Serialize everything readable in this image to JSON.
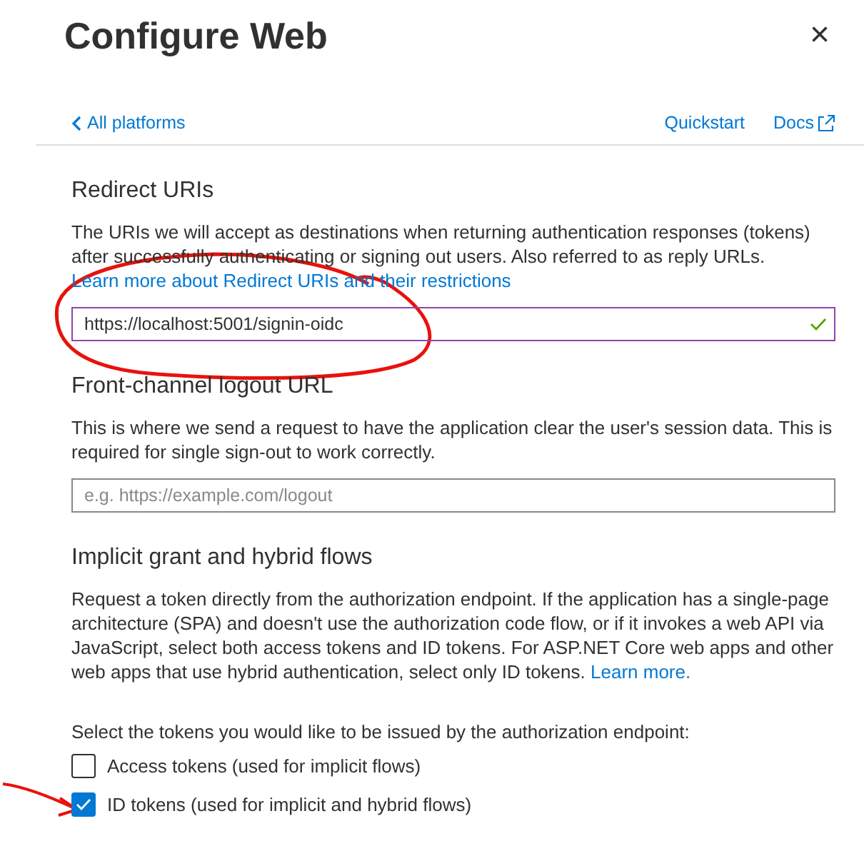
{
  "dialog": {
    "title": "Configure Web",
    "close": "×"
  },
  "nav": {
    "back": "All platforms",
    "links": [
      {
        "label": "Quickstart",
        "external": false
      },
      {
        "label": "Docs",
        "external": true
      }
    ]
  },
  "sections": [
    {
      "heading": "Redirect URIs",
      "text": "The URIs we will accept as destinations when returning authentication responses (tokens) after successfully authenticating or signing out users. Also referred to as reply URLs.",
      "link": "Learn more about Redirect URIs and their restrictions",
      "field": {
        "value": "https://localhost:5001/signin-oidc",
        "valid": true,
        "focused": true
      }
    },
    {
      "heading": "Front-channel logout URL",
      "text": "This is where we send a request to have the application clear the user's session data. This is required for single sign-out to work correctly.",
      "field": {
        "placeholder": "e.g. https://example.com/logout",
        "valid": false,
        "focused": false
      }
    },
    {
      "heading": "Implicit grant and hybrid flows",
      "text": "Request a token directly from the authorization endpoint. If the application has a single-page architecture (SPA) and doesn't use the authorization code flow, or if it invokes a web API via JavaScript, select both access tokens and ID tokens. For ASP.NET Core web apps and other web apps that use hybrid authentication, select only ID tokens.",
      "link": "Learn more.",
      "prompt": "Select the tokens you would like to be issued by the authorization endpoint:",
      "options": [
        {
          "label": "Access tokens (used for implicit flows)",
          "checked": false
        },
        {
          "label": "ID tokens (used for implicit and hybrid flows)",
          "checked": true
        }
      ]
    }
  ]
}
